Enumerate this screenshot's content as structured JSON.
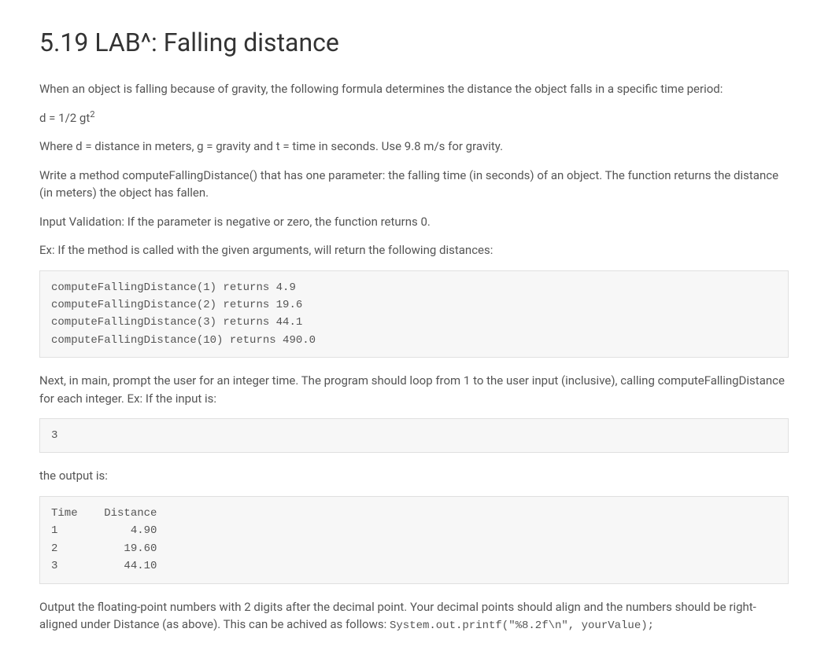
{
  "title": "5.19 LAB^: Falling distance",
  "p1": "When an object is falling because of gravity, the following formula determines the distance the object falls in a specific time period:",
  "formula_prefix": "d = 1/2 gt",
  "formula_sup": "2",
  "p2": "Where d = distance in meters, g = gravity and t = time in seconds. Use 9.8 m/s for gravity.",
  "p3": "Write a method computeFallingDistance() that has one parameter: the falling time (in seconds) of an object. The function returns the distance (in meters) the object has fallen.",
  "p4": "Input Validation: If the parameter is negative or zero, the function returns 0.",
  "p5": "Ex: If the method is called with the given arguments, will return the following distances:",
  "code1": "computeFallingDistance(1) returns 4.9\ncomputeFallingDistance(2) returns 19.6\ncomputeFallingDistance(3) returns 44.1\ncomputeFallingDistance(10) returns 490.0",
  "p6": "Next, in main, prompt the user for an integer time. The program should loop from 1 to the user input (inclusive), calling computeFallingDistance for each integer. Ex: If the input is:",
  "code2": "3",
  "p7": "the output is:",
  "code3": "Time    Distance\n1           4.90\n2          19.60\n3          44.10",
  "p8_prefix": "Output the floating-point numbers with 2 digits after the decimal point. Your decimal points should align and the numbers should be right-aligned under Distance (as above). This can be achived as follows: ",
  "p8_code": "System.out.printf(\"%8.2f\\n\", yourValue);"
}
